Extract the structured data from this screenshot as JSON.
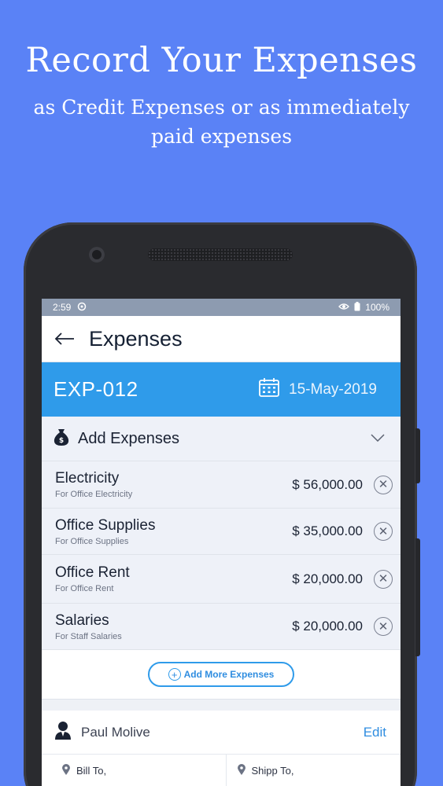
{
  "promo": {
    "headline": "Record Your Expenses",
    "subline": "as Credit Expenses or as immediately paid expenses"
  },
  "status_bar": {
    "time": "2:59",
    "battery": "100%"
  },
  "app_bar": {
    "title": "Expenses",
    "back_icon": "arrow-left-icon"
  },
  "expense_header": {
    "code": "EXP-012",
    "date": "15-May-2019",
    "calendar_icon": "calendar-icon",
    "background": "#2f9bea"
  },
  "add_expenses": {
    "label": "Add Expenses",
    "icon": "money-bag-icon",
    "chevron": "chevron-down-icon"
  },
  "expenses": [
    {
      "name": "Electricity",
      "description": "For Office Electricity",
      "amount": "$ 56,000.00"
    },
    {
      "name": "Office Supplies",
      "description": "For Office Supplies",
      "amount": "$ 35,000.00"
    },
    {
      "name": "Office Rent",
      "description": "For Office Rent",
      "amount": "$ 20,000.00"
    },
    {
      "name": "Salaries",
      "description": "For Staff Salaries",
      "amount": "$ 20,000.00"
    }
  ],
  "add_more_label": "Add More Expenses",
  "contact": {
    "name": "Paul Molive",
    "edit_label": "Edit"
  },
  "address": {
    "bill_to": "Bill To,",
    "ship_to": "Shipp To,"
  },
  "colors": {
    "background": "#5a82f6",
    "accent": "#2f9bea"
  }
}
